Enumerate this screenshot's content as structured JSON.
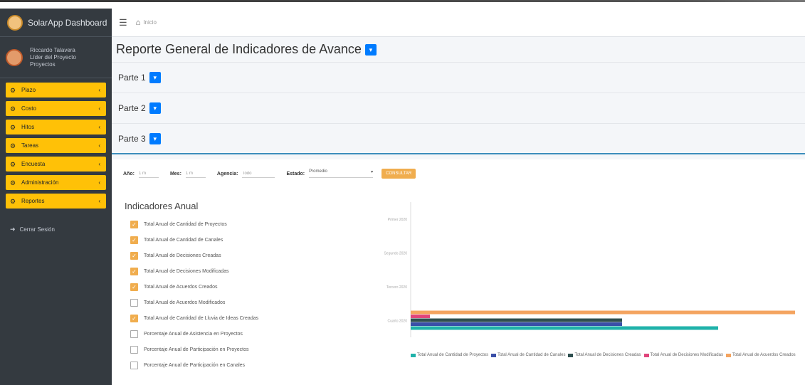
{
  "app": {
    "brand": "SolarApp Dashboard"
  },
  "user": {
    "line1": "Riccardo Talavera",
    "line2": "Líder del Proyecto",
    "line3": "Proyectos"
  },
  "sidebar": {
    "items": [
      {
        "label": "Plazo",
        "icon": "dashboard-icon"
      },
      {
        "label": "Costo",
        "icon": "dashboard-icon"
      },
      {
        "label": "Hitos",
        "icon": "dashboard-icon"
      },
      {
        "label": "Tareas",
        "icon": "dashboard-icon"
      },
      {
        "label": "Encuesta",
        "icon": "dashboard-icon"
      },
      {
        "label": "Administración",
        "icon": "dashboard-icon"
      },
      {
        "label": "Reportes",
        "icon": "dashboard-icon"
      }
    ],
    "logout": "Cerrar Sesión"
  },
  "navbar": {
    "breadcrumb": "Inicio"
  },
  "page": {
    "title": "Reporte General de Indicadores de Avance",
    "parts": [
      "Parte 1",
      "Parte 2",
      "Parte 3"
    ]
  },
  "filters": {
    "anio_label": "Año:",
    "anio_value": "1 m",
    "mes_label": "Mes:",
    "mes_value": "1 m",
    "agencia_label": "Agencia:",
    "agencia_value": "Todo",
    "estado_label": "Estado:",
    "estado_value": "Promedio",
    "consult_label": "CONSULTAR"
  },
  "indicators": {
    "title": "Indicadores Anual",
    "items": [
      {
        "label": "Total Anual de Cantidad de Proyectos",
        "checked": true
      },
      {
        "label": "Total Anual de Cantidad de Canales",
        "checked": true
      },
      {
        "label": "Total Anual de Decisiones Creadas",
        "checked": true
      },
      {
        "label": "Total Anual de Decisiones Modificadas",
        "checked": true
      },
      {
        "label": "Total Anual de Acuerdos Creados",
        "checked": true
      },
      {
        "label": "Total Anual de Acuerdos Modificados",
        "checked": false
      },
      {
        "label": "Total Anual de Cantidad de Lluvia de Ideas Creadas",
        "checked": true
      },
      {
        "label": "Porcentaje Anual de Asistencia en Proyectos",
        "checked": false
      },
      {
        "label": "Porcentaje Anual de Participación en Proyectos",
        "checked": false
      },
      {
        "label": "Porcentaje Anual de Participación en Canales",
        "checked": false
      }
    ]
  },
  "chart_data": {
    "type": "bar",
    "orientation": "horizontal",
    "categories": [
      "Primer 2020",
      "Segundo 2020",
      "Tercero 2020",
      "Cuarto 2020"
    ],
    "series": [
      {
        "name": "Total Anual de Cantidad de Proyectos",
        "color": "#20b2aa",
        "values": [
          0,
          0,
          0,
          80
        ]
      },
      {
        "name": "Total Anual de Cantidad de Canales",
        "color": "#3a4fa8",
        "values": [
          0,
          0,
          0,
          55
        ]
      },
      {
        "name": "Total Anual de Decisiones Creadas",
        "color": "#2f4f4f",
        "values": [
          0,
          0,
          0,
          55
        ]
      },
      {
        "name": "Total Anual de Decisiones Modificadas",
        "color": "#e0457b",
        "values": [
          0,
          0,
          0,
          5
        ]
      },
      {
        "name": "Total Anual de Acuerdos Creados",
        "color": "#f4a460",
        "values": [
          0,
          0,
          0,
          100
        ]
      }
    ],
    "legend_position": "bottom"
  }
}
